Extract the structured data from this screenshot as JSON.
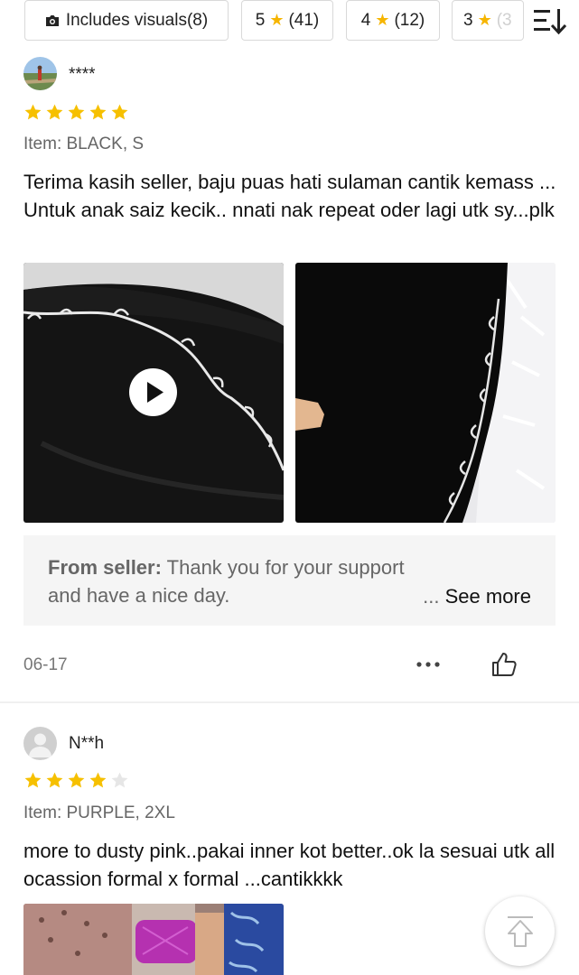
{
  "filters": {
    "visuals_label": "Includes visuals(8)",
    "chips": [
      {
        "rating": "5",
        "count": "(41)"
      },
      {
        "rating": "4",
        "count": "(12)"
      },
      {
        "rating": "3",
        "count": "(3"
      }
    ]
  },
  "reviews": [
    {
      "username": "****",
      "rating": 5,
      "item": "Item: BLACK, S",
      "text": "Terima kasih seller, baju puas hati sulaman cantik kemass ... Untuk anak saiz kecik.. nnati nak repeat oder lagi utk sy...plk",
      "seller_label": "From seller:",
      "seller_reply": "Thank you for your support and have a nice day.",
      "see_more_prefix": "...",
      "see_more_label": "See more",
      "date": "06-17"
    },
    {
      "username": "N**h",
      "rating": 4,
      "item": "Item: PURPLE, 2XL",
      "text": "more to dusty pink..pakai inner kot better..ok la sesuai utk all ocassion formal x formal ...cantikkkk"
    }
  ],
  "colors": {
    "star_filled": "#f6c000",
    "star_empty": "#e6e6e6",
    "seller_bg": "#f5f5f5",
    "text_muted": "#666666"
  },
  "icons": [
    "camera-icon",
    "star-icon",
    "sort-icon",
    "play-icon",
    "more-icon",
    "thumbs-up-icon",
    "scroll-top-icon",
    "default-avatar-icon"
  ]
}
